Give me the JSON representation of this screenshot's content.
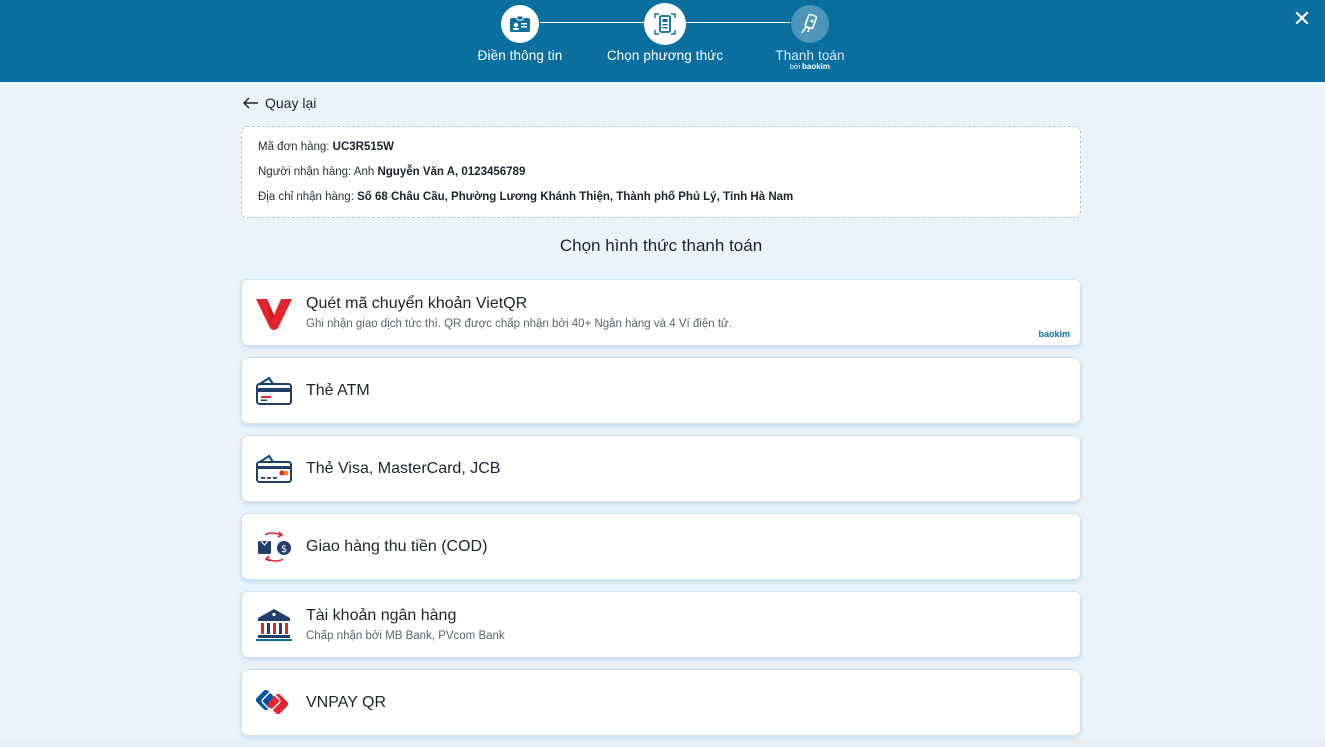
{
  "header": {
    "steps": [
      {
        "label": "Điền thông tin",
        "state": "done",
        "icon": "id-card-icon"
      },
      {
        "label": "Chọn phương thức",
        "state": "current",
        "icon": "payment-method-icon"
      },
      {
        "label": "Thanh toán",
        "state": "pending",
        "icon": "payment-hand-icon",
        "sub_prefix": "bởi",
        "sub_brand": "baokim"
      }
    ],
    "close_label": "✕"
  },
  "back": {
    "label": "Quay lại"
  },
  "order": {
    "code_label": "Mã đơn hàng: ",
    "code_value": "UC3R515W",
    "recipient_label": "Người nhận hàng: Anh ",
    "recipient_value": "Nguyễn Văn A, 0123456789",
    "address_label": "Địa chỉ nhận hàng: ",
    "address_value": "Số 68 Châu Cầu, Phường Lương Khánh Thiện, Thành phố Phủ Lý, Tỉnh Hà Nam"
  },
  "section_title": "Chọn hình thức thanh toán",
  "methods": [
    {
      "title": "Quét mã chuyển khoản VietQR",
      "desc": "Ghi nhận giao dịch tức thì. QR được chấp nhận bởi 40+ Ngân hàng và 4 Ví điện tử.",
      "brand": "baokim",
      "icon": "vietqr-logo-icon"
    },
    {
      "title": "Thẻ ATM",
      "desc": "",
      "icon": "atm-card-icon"
    },
    {
      "title": "Thẻ Visa, MasterCard, JCB",
      "desc": "",
      "icon": "credit-card-icon"
    },
    {
      "title": "Giao hàng thu tiền (COD)",
      "desc": "",
      "icon": "cod-exchange-icon"
    },
    {
      "title": "Tài khoản ngân hàng",
      "desc": "Chấp nhận bởi MB Bank, PVcom Bank",
      "icon": "bank-icon"
    },
    {
      "title": "VNPAY QR",
      "desc": "",
      "icon": "vnpay-logo-icon"
    }
  ],
  "colors": {
    "header_bg": "#0a6e9e",
    "page_bg": "#eaf3fa",
    "accent_red": "#e3262e"
  }
}
